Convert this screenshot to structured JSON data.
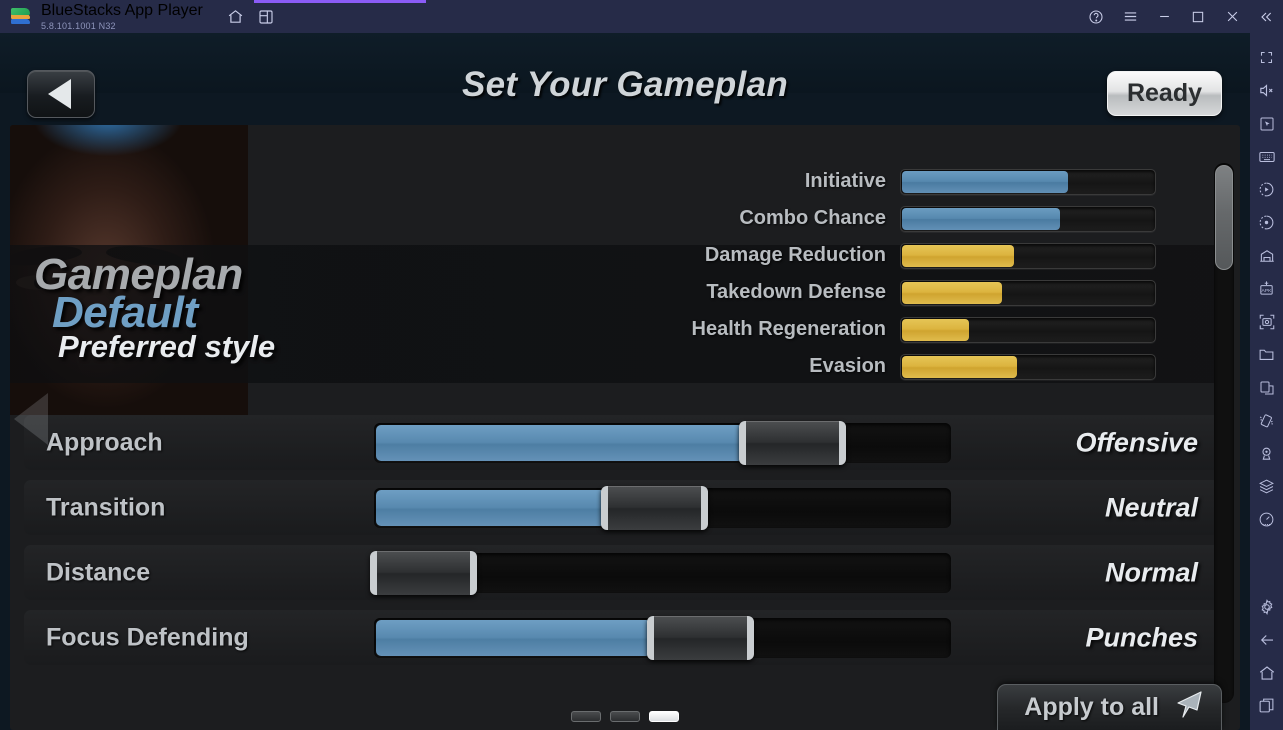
{
  "titlebar": {
    "app_name": "BlueStacks App Player",
    "version": "5.8.101.1001  N32",
    "icons": [
      "home-icon",
      "multi-instance-icon"
    ],
    "window_icons": [
      "help-icon",
      "menu-icon",
      "minimize-icon",
      "maximize-icon",
      "close-icon",
      "collapse-sidebar-icon"
    ],
    "accent_color": "#8b5cf6",
    "bar_color": "#262b48"
  },
  "sidebar": {
    "icons": [
      "fullscreen-icon",
      "mute-icon",
      "pointer-icon",
      "keyboard-icon",
      "macro-icon",
      "record-icon",
      "multi-instance-manager-icon",
      "install-apk-icon",
      "screenshot-icon",
      "media-folder-icon",
      "copy-icon",
      "shake-icon",
      "location-icon",
      "layers-icon",
      "performance-icon"
    ],
    "bottom_icons": [
      "settings-icon",
      "back-icon",
      "home-icon",
      "recents-icon"
    ]
  },
  "game": {
    "header": {
      "title": "Set Your Gameplan",
      "back_label": "Back",
      "ready_label": "Ready"
    },
    "gameplan": {
      "heading": "Gameplan",
      "name": "Default",
      "subtitle": "Preferred style"
    },
    "stats": {
      "rows": [
        {
          "label": "Initiative",
          "value": 66,
          "color": "#5688ae",
          "type": "blue"
        },
        {
          "label": "Combo Chance",
          "value": 63,
          "color": "#5688ae",
          "type": "blue"
        },
        {
          "label": "Damage Reduction",
          "value": 45,
          "color": "#dcb43f",
          "type": "gold"
        },
        {
          "label": "Takedown Defense",
          "value": 40,
          "color": "#dcb43f",
          "type": "gold"
        },
        {
          "label": "Health Regeneration",
          "value": 27,
          "color": "#dcb43f",
          "type": "gold"
        },
        {
          "label": "Evasion",
          "value": 46,
          "color": "#dcb43f",
          "type": "gold"
        }
      ]
    },
    "sliders": [
      {
        "label": "Approach",
        "value_label": "Offensive",
        "fill_pct": 64,
        "thumb_pct": 64
      },
      {
        "label": "Transition",
        "value_label": "Neutral",
        "fill_pct": 40,
        "thumb_pct": 40
      },
      {
        "label": "Distance",
        "value_label": "Normal",
        "fill_pct": 0,
        "thumb_pct": 0
      },
      {
        "label": "Focus Defending",
        "value_label": "Punches",
        "fill_pct": 48,
        "thumb_pct": 48
      }
    ],
    "footer": {
      "apply_label": "Apply to all",
      "apply_icon": "cursor-arrow-icon",
      "pages": [
        {
          "active": false
        },
        {
          "active": false
        },
        {
          "active": true
        }
      ]
    }
  }
}
